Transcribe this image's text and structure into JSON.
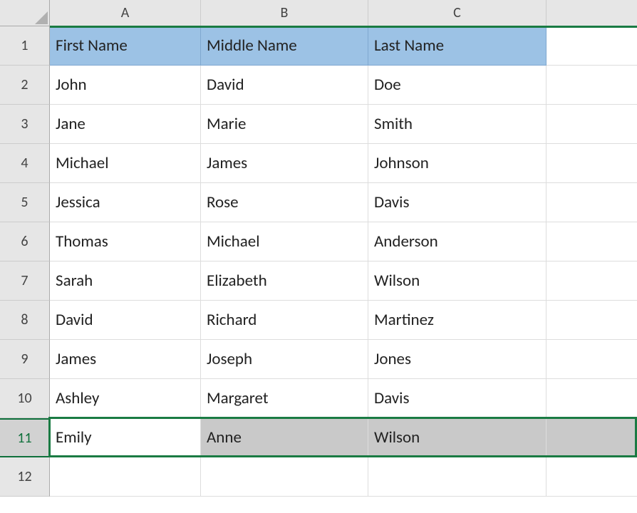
{
  "columns": [
    "A",
    "B",
    "C"
  ],
  "rows": [
    "1",
    "2",
    "3",
    "4",
    "5",
    "6",
    "7",
    "8",
    "9",
    "10",
    "11",
    "12"
  ],
  "headers": {
    "A": "First Name",
    "B": "Middle Name",
    "C": "Last Name"
  },
  "data": [
    {
      "A": "John",
      "B": "David",
      "C": "Doe"
    },
    {
      "A": "Jane",
      "B": "Marie",
      "C": "Smith"
    },
    {
      "A": "Michael",
      "B": "James",
      "C": "Johnson"
    },
    {
      "A": "Jessica",
      "B": "Rose",
      "C": "Davis"
    },
    {
      "A": "Thomas",
      "B": "Michael",
      "C": "Anderson"
    },
    {
      "A": "Sarah",
      "B": "Elizabeth",
      "C": "Wilson"
    },
    {
      "A": "David",
      "B": "Richard",
      "C": "Martinez"
    },
    {
      "A": "James",
      "B": "Joseph",
      "C": "Jones"
    },
    {
      "A": "Ashley",
      "B": "Margaret",
      "C": "Davis"
    },
    {
      "A": "Emily",
      "B": "Anne",
      "C": "Wilson"
    }
  ],
  "chart_data": {
    "type": "table",
    "title": "",
    "columns": [
      "First Name",
      "Middle Name",
      "Last Name"
    ],
    "rows": [
      [
        "John",
        "David",
        "Doe"
      ],
      [
        "Jane",
        "Marie",
        "Smith"
      ],
      [
        "Michael",
        "James",
        "Johnson"
      ],
      [
        "Jessica",
        "Rose",
        "Davis"
      ],
      [
        "Thomas",
        "Michael",
        "Anderson"
      ],
      [
        "Sarah",
        "Elizabeth",
        "Wilson"
      ],
      [
        "David",
        "Richard",
        "Martinez"
      ],
      [
        "James",
        "Joseph",
        "Jones"
      ],
      [
        "Ashley",
        "Margaret",
        "Davis"
      ],
      [
        "Emily",
        "Anne",
        "Wilson"
      ]
    ]
  },
  "selection": {
    "active_row": 11
  }
}
